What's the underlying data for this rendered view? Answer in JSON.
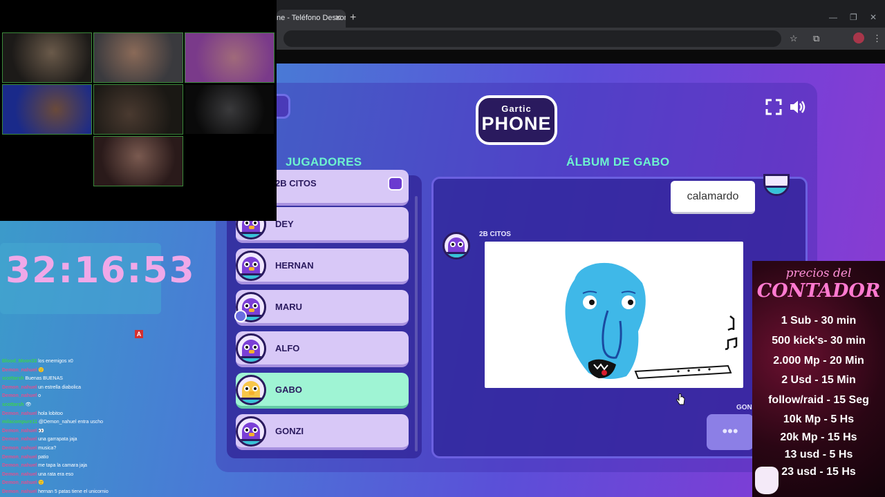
{
  "browser": {
    "tab_title": "ne - Teléfono Descon",
    "tab_close": "✕",
    "new_tab": "+",
    "minimize": "—",
    "restore": "❐",
    "close": "✕",
    "star_icon": "☆",
    "extensions_icon": "⧉",
    "menu_icon": "⋮"
  },
  "game": {
    "logo_top": "Gartic",
    "logo_main": "PHONE",
    "players_heading": "JUGADORES",
    "album_heading": "ÁLBUM DE GABO",
    "fullscreen_icon": "fullscreen-icon",
    "sound_icon": "speaker-icon",
    "players": [
      {
        "name": "2B CITOS",
        "host": true
      },
      {
        "name": "DEY"
      },
      {
        "name": "HERNAN"
      },
      {
        "name": "MARU",
        "you": true
      },
      {
        "name": "ALFO"
      },
      {
        "name": "GABO",
        "active": true
      },
      {
        "name": "GONZI"
      }
    ],
    "album": {
      "phrase": "calamardo",
      "drawing_author": "2B CITOS",
      "next_author": "GON",
      "typing_indicator": "•••"
    }
  },
  "stream": {
    "timer": "32:16:53",
    "alert_badge": "A",
    "chat": [
      {
        "user": "Blood_Moon33",
        "text": "los enemigos x0",
        "green": true
      },
      {
        "user": "Demon_nahuel",
        "text": "🙂"
      },
      {
        "user": "scottarsh",
        "text": "Buenas BUENAS",
        "green": true
      },
      {
        "user": "Demon_nahuel",
        "text": "un estrella diabolica"
      },
      {
        "user": "Demon_nahuel",
        "text": "o"
      },
      {
        "user": "scottarsh",
        "text": "👁",
        "green": true
      },
      {
        "user": "Demon_nahuel",
        "text": "hola lobitoo"
      },
      {
        "user": "milacompure11",
        "text": "@Demon_nahuel entra uscho",
        "green": true
      },
      {
        "user": "Demon_nahuel",
        "text": "👀"
      },
      {
        "user": "Demon_nahuel",
        "text": "una garrapata jaja"
      },
      {
        "user": "Demon_nahuel",
        "text": "musica?"
      },
      {
        "user": "Demon_nahuel",
        "text": "patio"
      },
      {
        "user": "Demon_nahuel",
        "text": "me tapa la camara jaja"
      },
      {
        "user": "Demon_nahuel",
        "text": "una rata era eso"
      },
      {
        "user": "Demon_nahuel",
        "text": "🙂"
      },
      {
        "user": "Demon_nahuel",
        "text": "hernan 5 patas tiene el unicornio"
      }
    ],
    "prices": {
      "title_line1": "precios del",
      "title_line2": "CONTADOR",
      "lines": [
        "1 Sub - 30 min",
        "500 kick's- 30 min",
        "2.000 Mp - 20 Min",
        "2 Usd - 15 Min",
        "follow/raid - 15 Seg",
        "10k Mp - 5 Hs",
        "20k Mp - 15 Hs",
        "13 usd - 5 Hs",
        "23 usd - 15 Hs"
      ]
    }
  }
}
